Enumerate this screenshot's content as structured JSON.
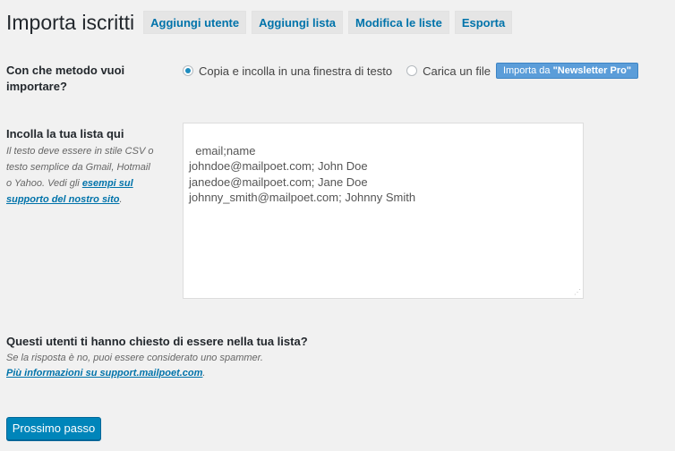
{
  "header": {
    "title": "Importa iscritti",
    "tabs": [
      {
        "label": "Aggiungi utente"
      },
      {
        "label": "Aggiungi lista"
      },
      {
        "label": "Modifica le liste"
      },
      {
        "label": "Esporta"
      }
    ]
  },
  "method": {
    "label_line1": "Con che metodo vuoi",
    "label_line2": "importare?",
    "options": [
      {
        "label": "Copia e incolla in una finestra di testo",
        "checked": true
      },
      {
        "label": "Carica un file",
        "checked": false
      }
    ],
    "newsletter_pro_button": {
      "prefix": "Importa da ",
      "bold": "\"Newsletter Pro\""
    }
  },
  "paste": {
    "label": "Incolla la tua lista qui",
    "desc_line1": "Il testo deve essere in stile CSV o",
    "desc_line2": "testo semplice da Gmail, Hotmail",
    "desc_line3_prefix": "o Yahoo. Vedi gli ",
    "desc_link_part1": "esempi sul",
    "desc_link_part2": "supporto del nostro sito",
    "desc_line4_suffix": ".",
    "content": "email;name\njohndoe@mailpoet.com; John Doe\njanedoe@mailpoet.com; Jane Doe\njohnny_smith@mailpoet.com; Johnny Smith"
  },
  "consent": {
    "question": "Questi utenti ti hanno chiesto di essere nella tua lista?",
    "warning": "Se la risposta è no, puoi essere considerato uno spammer.",
    "link": "Più informazioni su support.mailpoet.com",
    "link_suffix": "."
  },
  "actions": {
    "next_label": "Prossimo passo"
  }
}
